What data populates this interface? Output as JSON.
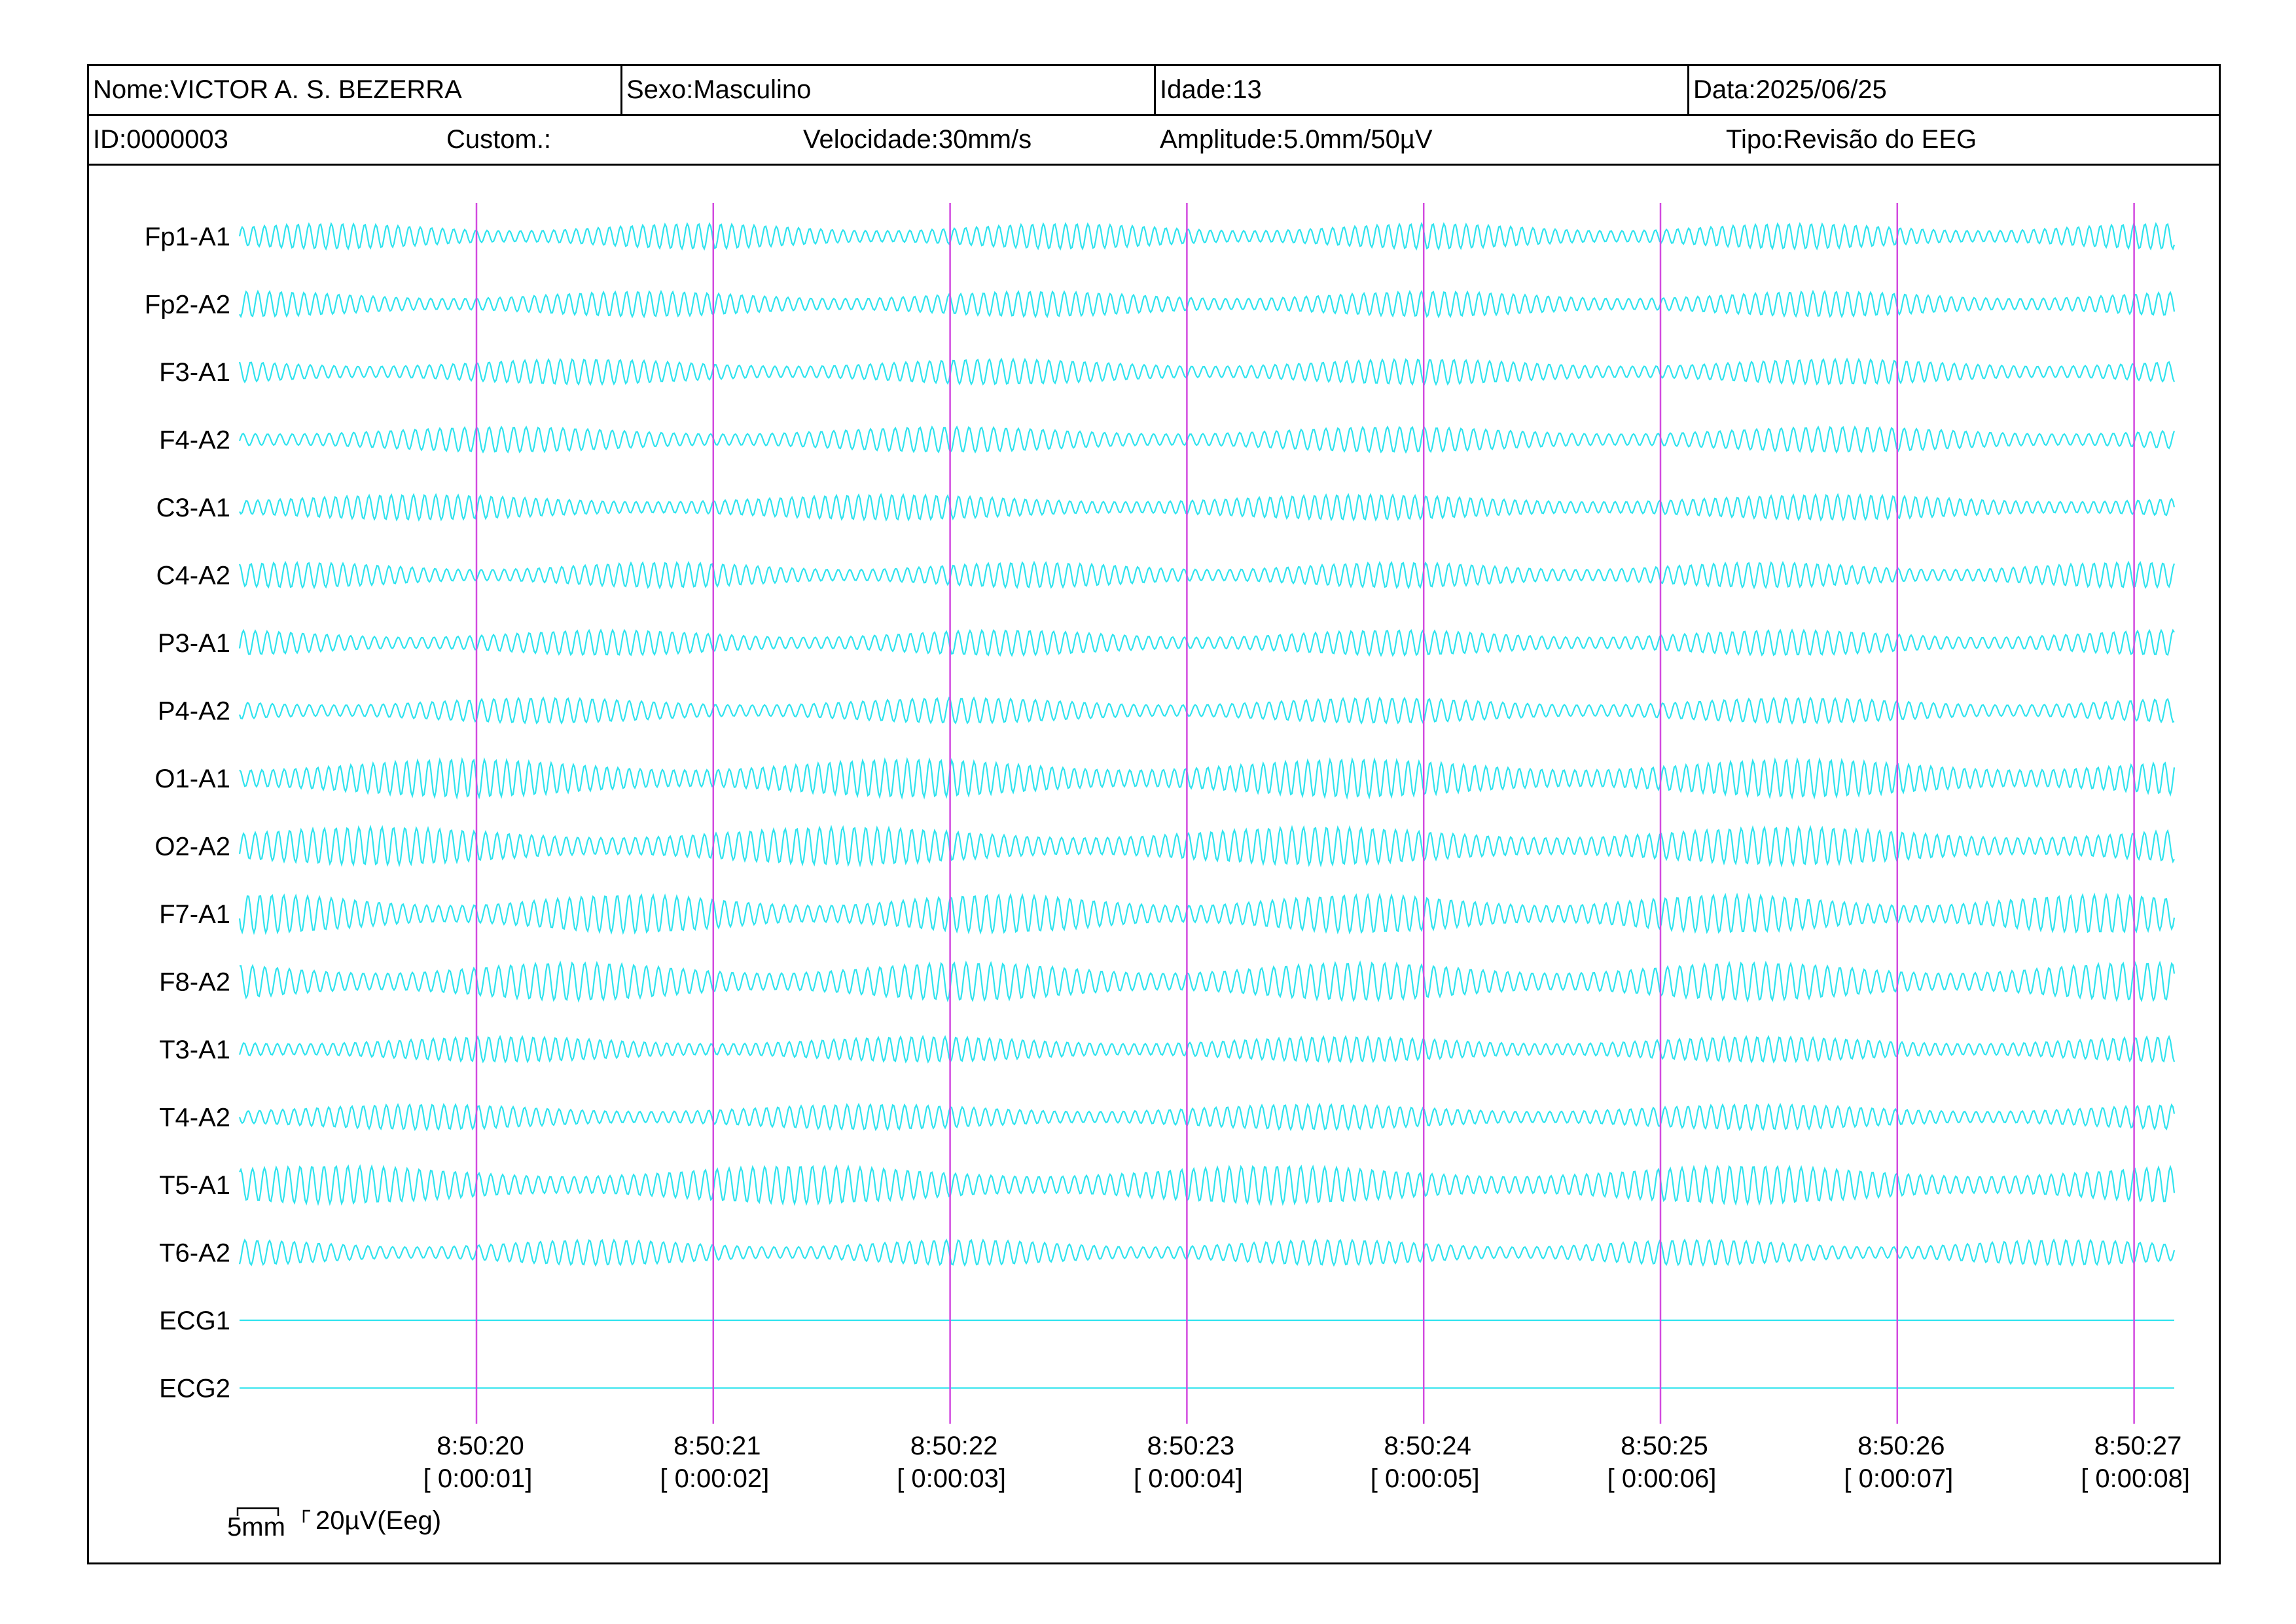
{
  "header": {
    "nome": "Nome:VICTOR A. S. BEZERRA",
    "sexo": "Sexo:Masculino",
    "idade": "Idade:13",
    "data": "Data:2025/06/25",
    "id": "ID:0000003",
    "custom": "Custom.:",
    "velocidade": "Velocidade:30mm/s",
    "amplitude": "Amplitude:5.0mm/50µV",
    "tipo": "Tipo:Revisão do EEG"
  },
  "channels": [
    {
      "label": "Fp1-A1",
      "type": "eeg"
    },
    {
      "label": "Fp2-A2",
      "type": "eeg"
    },
    {
      "label": "F3-A1",
      "type": "eeg"
    },
    {
      "label": "F4-A2",
      "type": "eeg"
    },
    {
      "label": "C3-A1",
      "type": "eeg"
    },
    {
      "label": "C4-A2",
      "type": "eeg"
    },
    {
      "label": "P3-A1",
      "type": "eeg"
    },
    {
      "label": "P4-A2",
      "type": "eeg"
    },
    {
      "label": "O1-A1",
      "type": "eeg"
    },
    {
      "label": "O2-A2",
      "type": "eeg"
    },
    {
      "label": "F7-A1",
      "type": "eeg"
    },
    {
      "label": "F8-A2",
      "type": "eeg"
    },
    {
      "label": "T3-A1",
      "type": "eeg"
    },
    {
      "label": "T4-A2",
      "type": "eeg"
    },
    {
      "label": "T5-A1",
      "type": "eeg"
    },
    {
      "label": "T6-A2",
      "type": "eeg"
    },
    {
      "label": "ECG1",
      "type": "flat"
    },
    {
      "label": "ECG2",
      "type": "flat"
    }
  ],
  "time_markers": [
    {
      "clock": "8:50:20",
      "elapsed": "[ 0:00:01]"
    },
    {
      "clock": "8:50:21",
      "elapsed": "[ 0:00:02]"
    },
    {
      "clock": "8:50:22",
      "elapsed": "[ 0:00:03]"
    },
    {
      "clock": "8:50:23",
      "elapsed": "[ 0:00:04]"
    },
    {
      "clock": "8:50:24",
      "elapsed": "[ 0:00:05]"
    },
    {
      "clock": "8:50:25",
      "elapsed": "[ 0:00:06]"
    },
    {
      "clock": "8:50:26",
      "elapsed": "[ 0:00:07]"
    },
    {
      "clock": "8:50:27",
      "elapsed": "[ 0:00:08]"
    }
  ],
  "calibration": {
    "time_scale": "5mm",
    "amplitude_scale": "20µV(Eeg)"
  },
  "colors": {
    "trace": "#2fe3ee",
    "marker": "#d24adf",
    "border": "#000000"
  }
}
